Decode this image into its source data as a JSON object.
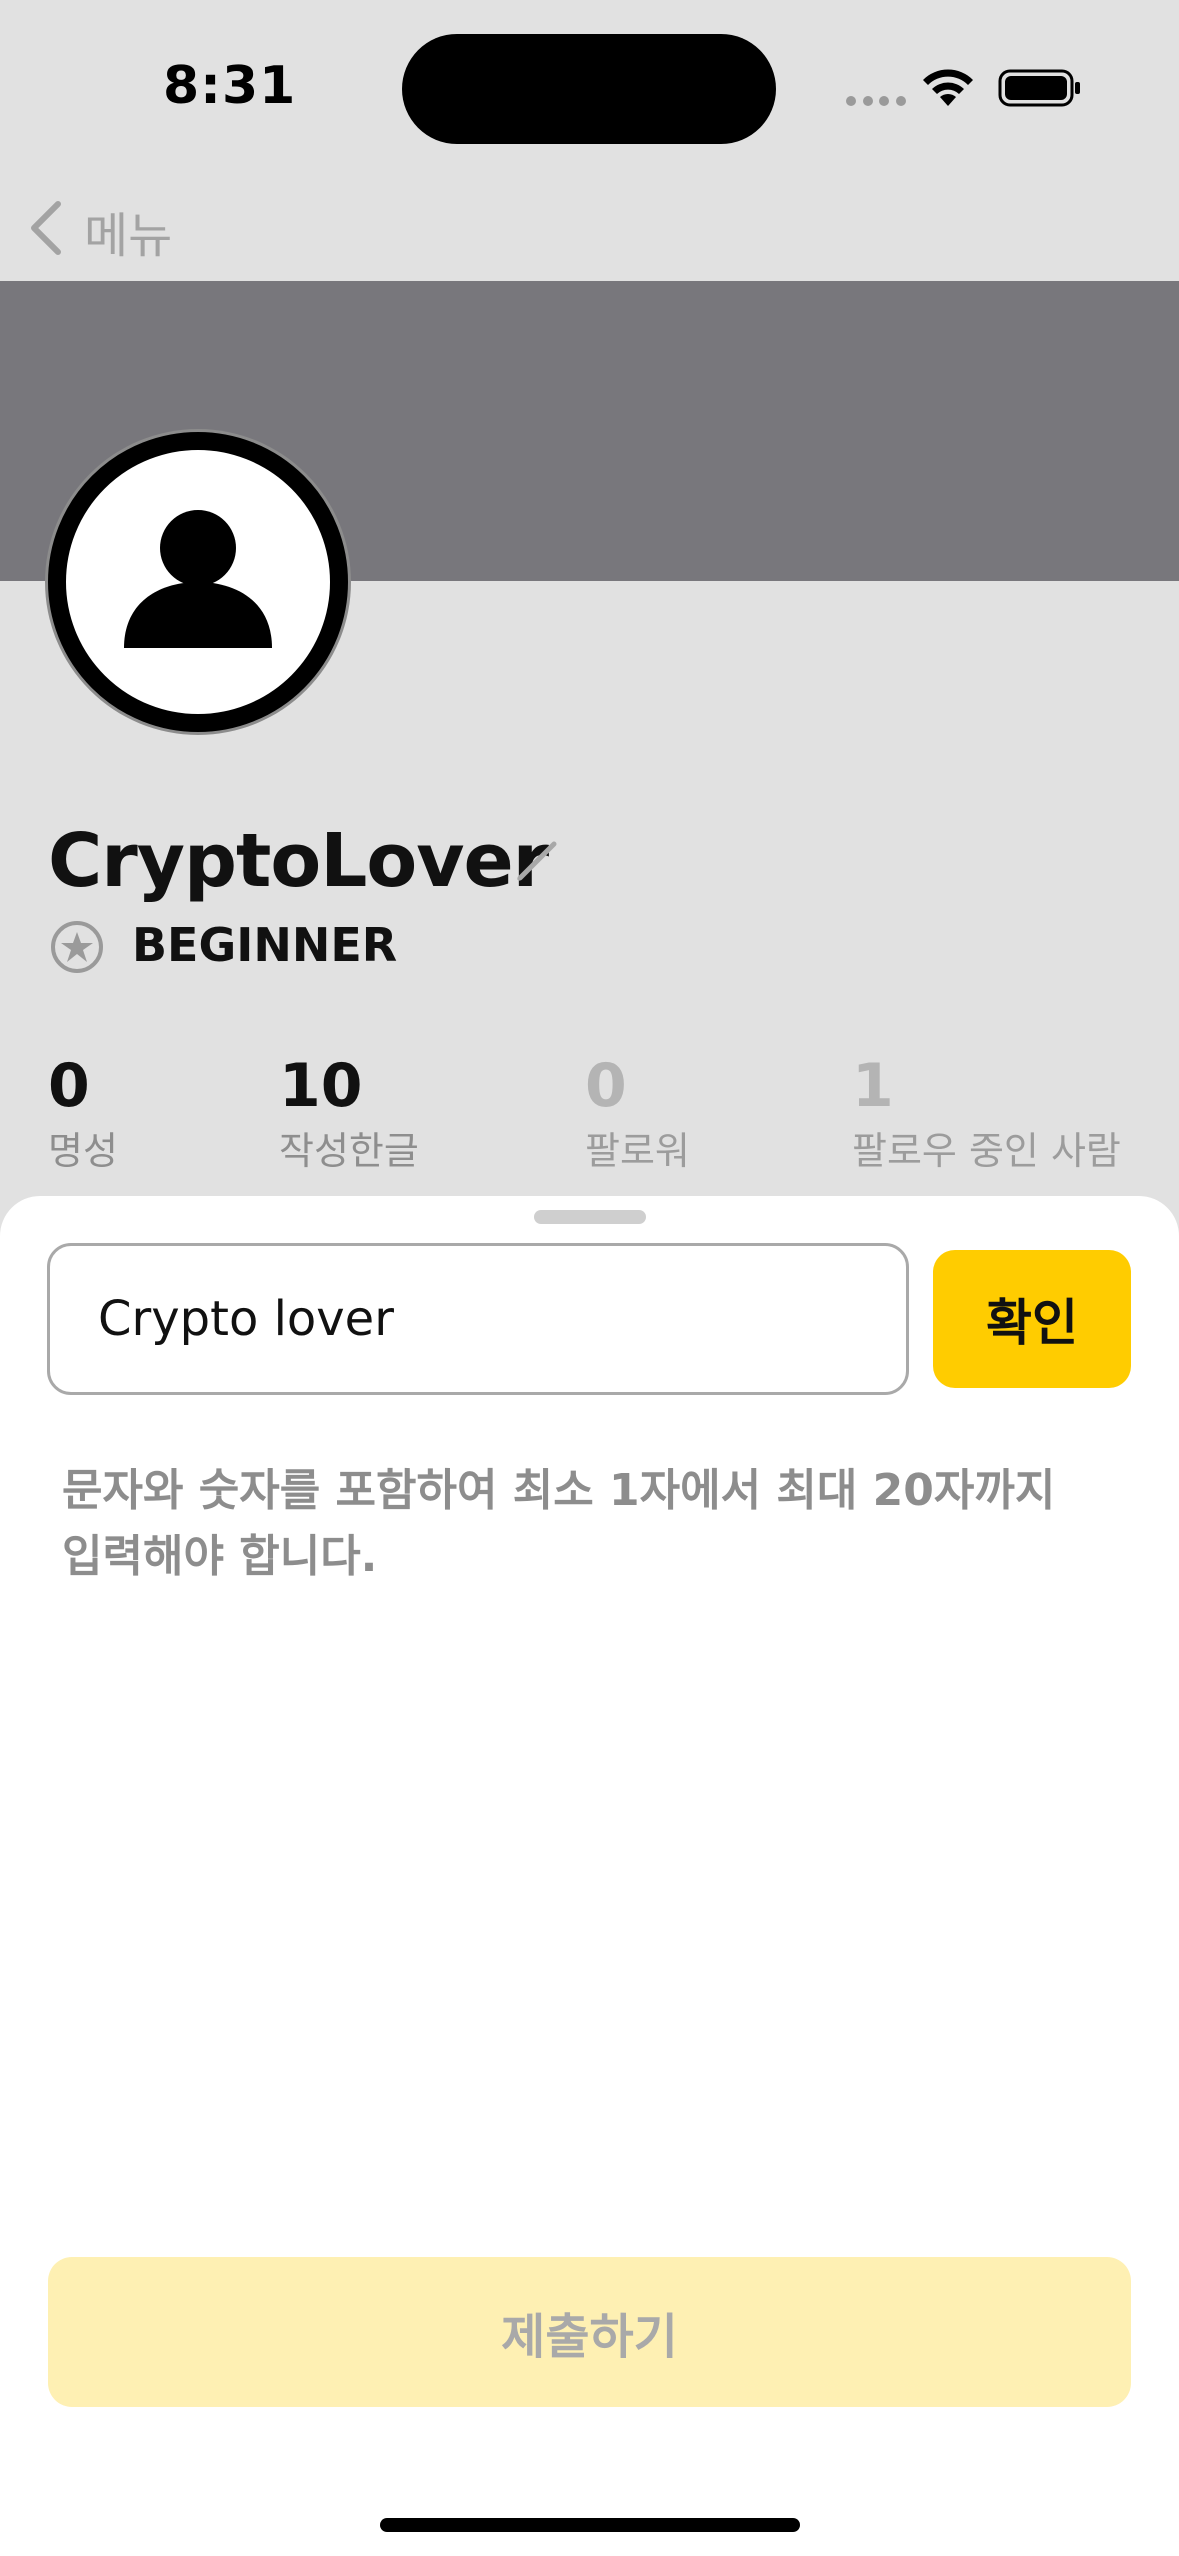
{
  "status_bar": {
    "time": "8:31",
    "icons": [
      "signal-dots-icon",
      "wifi-icon",
      "battery-icon"
    ]
  },
  "navbar": {
    "back_label": "메뉴",
    "back_icon": "chevron-left-icon"
  },
  "profile": {
    "username": "CryptoLover",
    "edit_icon": "pencil-icon",
    "level_icon": "star-badge-icon",
    "level": "BEGINNER",
    "stats": [
      {
        "value": "0",
        "label": "명성"
      },
      {
        "value": "10",
        "label": "작성한글"
      },
      {
        "value": "0",
        "label": "팔로워"
      },
      {
        "value": "1",
        "label": "팔로우 중인 사람"
      }
    ]
  },
  "sheet": {
    "input_value": "Crypto lover",
    "confirm_label": "확인",
    "help_line1": "문자와 숫자를 포함하여 최소 1자에서 최대 20자까지",
    "help_line2": "입력해야 합니다.",
    "submit_label": "제출하기"
  },
  "colors": {
    "accent": "#ffcc00",
    "accent_disabled": "#fef0b3",
    "banner": "#78777c",
    "dimmed_background": "#e1e1e1"
  }
}
